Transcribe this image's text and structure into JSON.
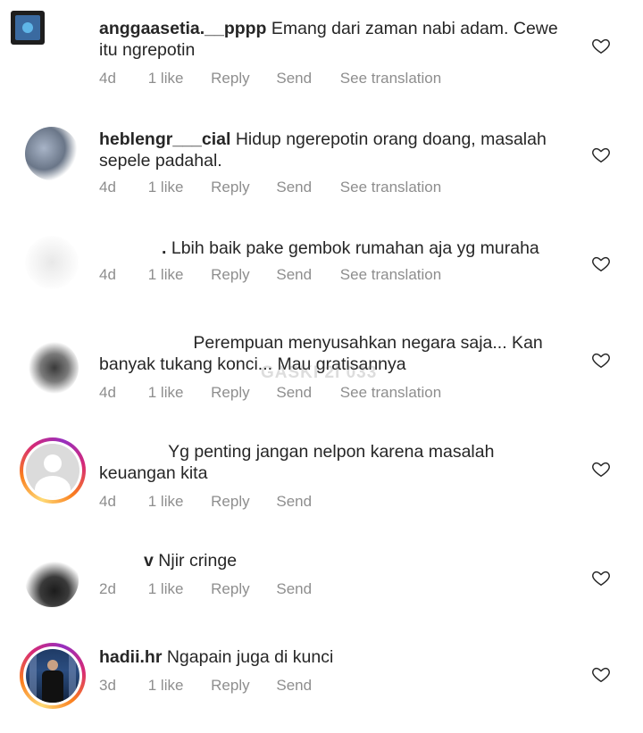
{
  "comments": [
    {
      "username": "anggaasetia.__pppp",
      "text": "Emang dari zaman nabi adam. Cewe itu ngrepotin",
      "age": "4d",
      "likes": "1 like",
      "reply": "Reply",
      "send": "Send",
      "translate": "See translation",
      "avatar_icon": "square-blue-avatar-icon"
    },
    {
      "username": "heblengr___cial",
      "text": "Hidup ngerepotin orang doang, masalah sepele padahal.",
      "age": "4d",
      "likes": "1 like",
      "reply": "Reply",
      "send": "Send",
      "translate": "See translation",
      "avatar_icon": "photo-avatar-icon"
    },
    {
      "username": "",
      "text": "Lbih baik pake gembok rumahan aja yg muraha",
      "age": "4d",
      "likes": "1 like",
      "reply": "Reply",
      "send": "Send",
      "translate": "See translation",
      "avatar_icon": "photo-avatar-icon"
    },
    {
      "username": "",
      "text": "Perempuan menyusahkan negara saja... Kan banyak tukang konci... Mau gratisannya",
      "age": "4d",
      "likes": "1 like",
      "reply": "Reply",
      "send": "Send",
      "translate": "See translation",
      "avatar_icon": "photo-avatar-icon"
    },
    {
      "username": "",
      "text": "Yg penting jangan nelpon karena masalah keuangan kita",
      "age": "4d",
      "likes": "1 like",
      "reply": "Reply",
      "send": "Send",
      "avatar_icon": "default-avatar-icon"
    },
    {
      "username": "",
      "text": "Njir cringe",
      "age": "2d",
      "likes": "1 like",
      "reply": "Reply",
      "send": "Send",
      "avatar_icon": "photo-avatar-icon"
    },
    {
      "username": "hadii.hr",
      "text": "Ngapain juga di kunci",
      "age": "3d",
      "likes": "1 like",
      "reply": "Reply",
      "send": "Send",
      "avatar_icon": "photo-avatar-icon"
    }
  ],
  "watermark": "GASKI 2I 033",
  "colors": {
    "text": "#262626",
    "meta": "#8e8e8e",
    "ring_start": "#fa7e1e",
    "ring_end": "#d62976"
  }
}
